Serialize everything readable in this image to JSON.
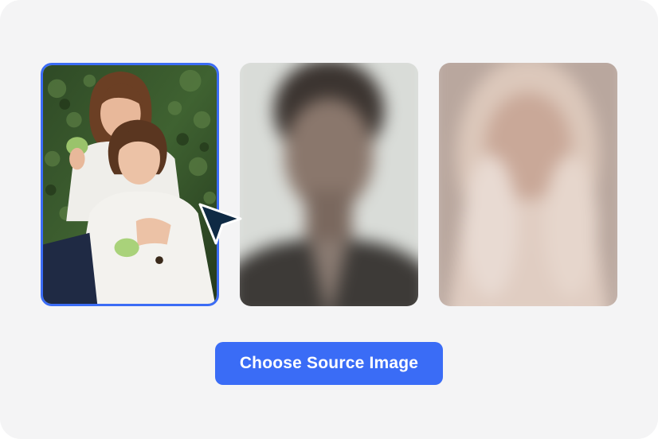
{
  "cta": {
    "label": "Choose Source Image"
  },
  "colors": {
    "accent": "#3a6cf6",
    "selection_border": "#3b6cf5",
    "panel_background": "#f4f4f5",
    "cursor": "#0f2a44"
  },
  "cards": [
    {
      "id": "source-photo",
      "state": "selected",
      "icon": "photo-two-women"
    },
    {
      "id": "candidate-photo-1",
      "state": "blurred",
      "icon": "photo-portrait-man"
    },
    {
      "id": "candidate-photo-2",
      "state": "blurred",
      "icon": "photo-portrait-woman"
    }
  ],
  "pointer": {
    "icon": "arrow-cursor-icon"
  }
}
